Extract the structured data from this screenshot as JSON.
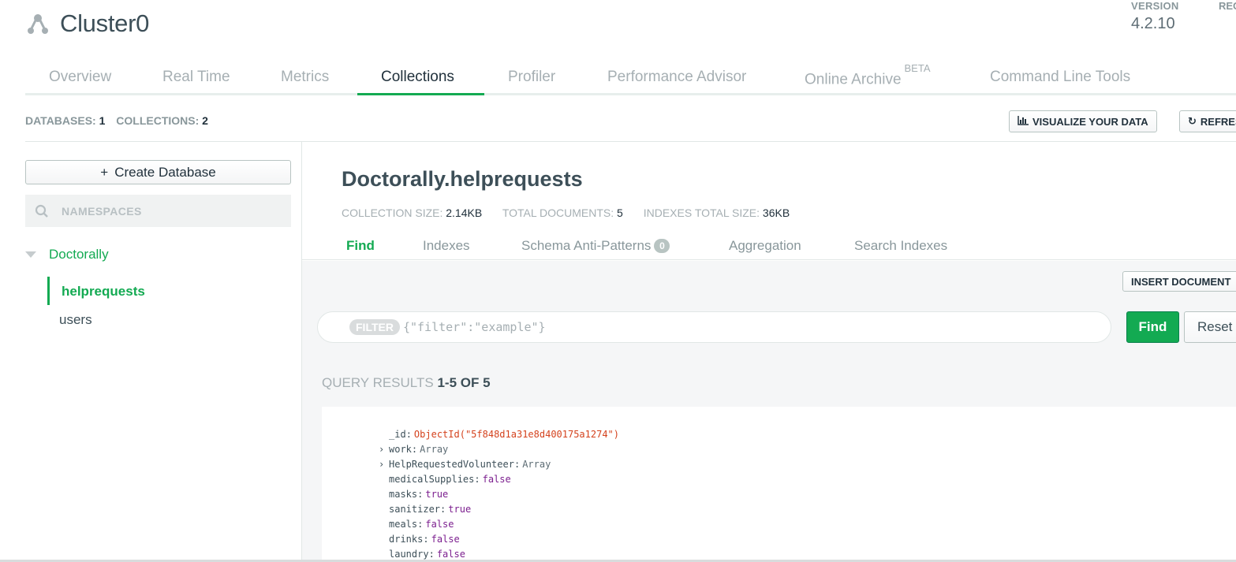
{
  "header": {
    "cluster_name": "Cluster0",
    "version_label": "VERSION",
    "version_value": "4.2.10",
    "region_label": "REG"
  },
  "top_tabs": [
    {
      "label": "Overview",
      "active": false
    },
    {
      "label": "Real Time",
      "active": false
    },
    {
      "label": "Metrics",
      "active": false
    },
    {
      "label": "Collections",
      "active": true
    },
    {
      "label": "Profiler",
      "active": false
    },
    {
      "label": "Performance Advisor",
      "active": false
    },
    {
      "label": "Online Archive",
      "sup": "BETA",
      "active": false
    },
    {
      "label": "Command Line Tools",
      "active": false
    }
  ],
  "stats": {
    "databases_label": "DATABASES:",
    "databases_value": "1",
    "collections_label": "COLLECTIONS:",
    "collections_value": "2"
  },
  "toolbar": {
    "visualize_label": "VISUALIZE YOUR DATA",
    "refresh_label": "REFRESH"
  },
  "sidebar": {
    "create_db_label": "Create Database",
    "search_placeholder": "NAMESPACES",
    "database": "Doctorally",
    "collections": [
      {
        "name": "helprequests",
        "active": true
      },
      {
        "name": "users",
        "active": false
      }
    ]
  },
  "main": {
    "namespace_title": "Doctorally.helprequests",
    "collection_size_label": "COLLECTION SIZE:",
    "collection_size_value": "2.14KB",
    "total_documents_label": "TOTAL DOCUMENTS:",
    "total_documents_value": "5",
    "indexes_size_label": "INDEXES TOTAL SIZE:",
    "indexes_size_value": "36KB",
    "sub_tabs": [
      {
        "label": "Find",
        "active": true
      },
      {
        "label": "Indexes",
        "active": false
      },
      {
        "label": "Schema Anti-Patterns",
        "badge": "0",
        "active": false
      },
      {
        "label": "Aggregation",
        "active": false
      },
      {
        "label": "Search Indexes",
        "active": false
      }
    ],
    "insert_document_label": "INSERT DOCUMENT",
    "filter_pill": "FILTER",
    "filter_placeholder": "{\"filter\":\"example\"}",
    "find_label": "Find",
    "reset_label": "Reset",
    "query_results_label": "QUERY RESULTS",
    "query_results_value": "1-5 OF 5"
  },
  "document": {
    "fields": [
      {
        "key": "_id",
        "value": "ObjectId(\"5f848d1a31e8d400175a1274\")",
        "kind": "str",
        "expandable": false
      },
      {
        "key": "work",
        "value": "Array",
        "kind": "typ",
        "expandable": true
      },
      {
        "key": "HelpRequestedVolunteer",
        "value": "Array",
        "kind": "typ",
        "expandable": true
      },
      {
        "key": "medicalSupplies",
        "value": "false",
        "kind": "bool",
        "expandable": false
      },
      {
        "key": "masks",
        "value": "true",
        "kind": "bool",
        "expandable": false
      },
      {
        "key": "sanitizer",
        "value": "true",
        "kind": "bool",
        "expandable": false
      },
      {
        "key": "meals",
        "value": "false",
        "kind": "bool",
        "expandable": false
      },
      {
        "key": "drinks",
        "value": "false",
        "kind": "bool",
        "expandable": false
      },
      {
        "key": "laundry",
        "value": "false",
        "kind": "bool",
        "expandable": false
      }
    ]
  }
}
